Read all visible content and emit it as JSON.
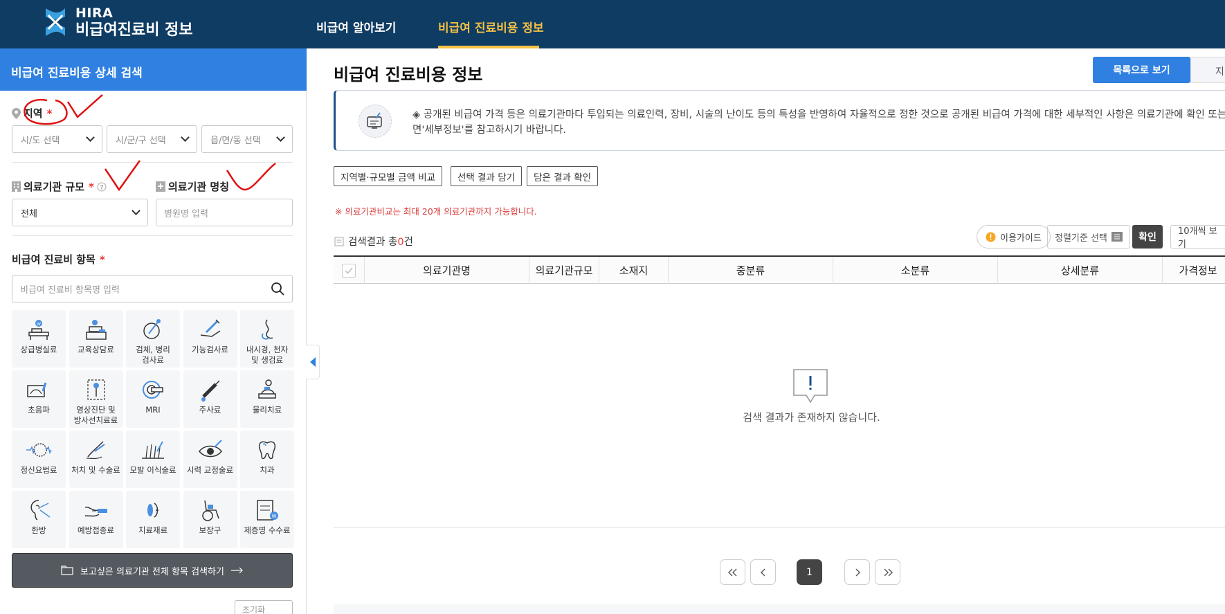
{
  "header": {
    "brand_top": "HIRA",
    "brand_bottom": "비급여진료비 정보",
    "nav": [
      {
        "label": "비급여 알아보기",
        "active": false
      },
      {
        "label": "비급여 진료비용 정보",
        "active": true
      }
    ]
  },
  "sidebar": {
    "title": "비급여 진료비용 상세 검색",
    "region": {
      "label": "지역",
      "required_mark": "*",
      "sido_placeholder": "시/도 선택",
      "sigungu_placeholder": "시/군/구 선택",
      "dong_placeholder": "읍/면/동 선택"
    },
    "scale": {
      "label": "의료기관 규모",
      "required_mark": "*",
      "value": "전체"
    },
    "name": {
      "label": "의료기관 명칭",
      "placeholder": "병원명 입력"
    },
    "items": {
      "label": "비급여 진료비 항목",
      "required_mark": "*",
      "search_placeholder": "비급여 진료비 항목명 입력"
    },
    "categories": [
      {
        "label": "상급병실료",
        "icon": "hospital-bed-icon"
      },
      {
        "label": "교육상담료",
        "icon": "counseling-icon"
      },
      {
        "label": "검체, 병리\n검사료",
        "icon": "specimen-icon"
      },
      {
        "label": "기능검사료",
        "icon": "function-test-icon"
      },
      {
        "label": "내시경, 천자\n및 생검료",
        "icon": "endoscope-icon"
      },
      {
        "label": "초음파",
        "icon": "ultrasound-icon"
      },
      {
        "label": "영상진단 및\n방사선치료료",
        "icon": "xray-icon"
      },
      {
        "label": "MRI",
        "icon": "mri-icon"
      },
      {
        "label": "주사료",
        "icon": "syringe-icon"
      },
      {
        "label": "물리치료",
        "icon": "physical-therapy-icon"
      },
      {
        "label": "정신요법료",
        "icon": "brain-icon"
      },
      {
        "label": "처치 및 수술료",
        "icon": "scalpel-icon"
      },
      {
        "label": "모발 이식술료",
        "icon": "hair-icon"
      },
      {
        "label": "시력 교정술료",
        "icon": "eye-icon"
      },
      {
        "label": "치과",
        "icon": "tooth-icon"
      },
      {
        "label": "한방",
        "icon": "acupuncture-icon"
      },
      {
        "label": "예방접종료",
        "icon": "vaccine-icon"
      },
      {
        "label": "치료재료",
        "icon": "material-icon"
      },
      {
        "label": "보장구",
        "icon": "wheelchair-icon"
      },
      {
        "label": "제증명 수수료",
        "icon": "certificate-icon"
      }
    ],
    "search_all_label": "보고싶은 의료기관 전체 항목 검색하기",
    "reset_label": "초기화"
  },
  "main": {
    "title": "비급여 진료비용 정보",
    "view_list_label": "목록으로 보기",
    "view_map_label": "지",
    "notice": "◈ 공개된 비급여 가격 등은 의료기관마다 투입되는 의료인력, 장비, 시술의 난이도 등의 특성을 반영하여 자율적으로 정한 것으로 공개된 비급여 가격에 대한 세부적인 사항은 의료기관에 확인 또는\n면'세부정보'를 참고하시기 바랍니다.",
    "buttons": [
      "지역별·규모별 금액 비교",
      "선택 결과 담기",
      "담은 결과 확인"
    ],
    "warning": "※ 의료기관비교는 최대 20개 의료기관까지 가능합니다.",
    "result_prefix": "검색결과 총",
    "result_count": "0",
    "result_suffix": "건",
    "guide_label": "이용가이드",
    "sort_label": "정렬기준 선택",
    "confirm_label": "확인",
    "per_page_label": "10개씩 보기",
    "columns": [
      "의료기관명",
      "의료기관규모",
      "소재지",
      "중분류",
      "소분류",
      "상세분류",
      "가격정보"
    ],
    "empty_message": "검색 결과가 존재하지 않습니다.",
    "pagination": {
      "current": "1"
    }
  },
  "colors": {
    "header_bg": "#0f3c63",
    "accent": "#2f80e0",
    "active_nav": "#f5c144",
    "required": "#e53935"
  }
}
